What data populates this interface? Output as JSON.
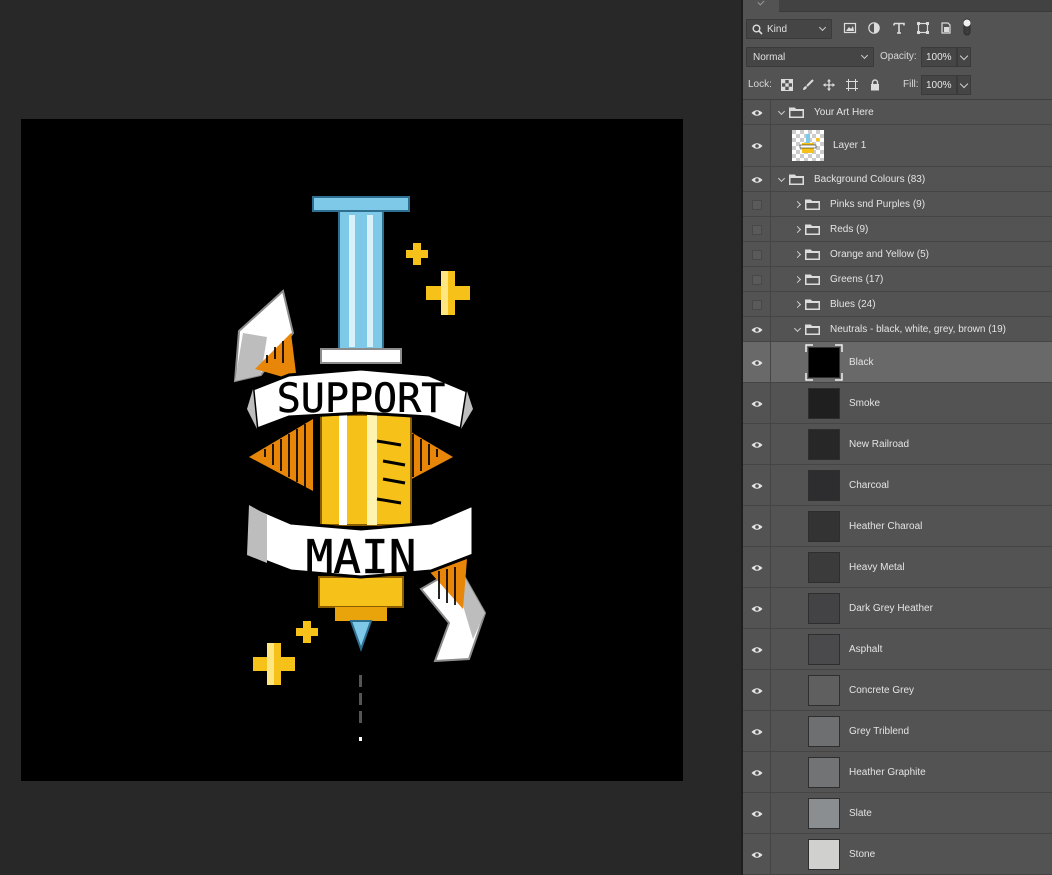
{
  "panel": {
    "filter": {
      "kind_label": "Kind",
      "icons": [
        "search-icon",
        "image-filter-icon",
        "adjustment-filter-icon",
        "type-filter-icon",
        "shape-filter-icon",
        "smart-object-filter-icon",
        "filter-toggle-icon"
      ]
    },
    "blend": {
      "mode": "Normal",
      "opacity_label": "Opacity:",
      "opacity_value": "100%"
    },
    "lock": {
      "label": "Lock:",
      "icons": [
        "lock-transparent-icon",
        "lock-paint-icon",
        "lock-position-icon",
        "lock-artboard-icon",
        "lock-all-icon"
      ],
      "fill_label": "Fill:",
      "fill_value": "100%"
    }
  },
  "layers": [
    {
      "type": "group",
      "name": "Your Art Here",
      "visible": true,
      "expanded": true,
      "depth": 0
    },
    {
      "type": "layer",
      "name": "Layer 1",
      "visible": true,
      "depth": 1,
      "thumb": "art"
    },
    {
      "type": "group",
      "name": "Background Colours (83)",
      "visible": true,
      "expanded": true,
      "depth": 0
    },
    {
      "type": "group",
      "name": "Pinks snd Purples (9)",
      "visible": false,
      "expanded": false,
      "depth": 1
    },
    {
      "type": "group",
      "name": "Reds (9)",
      "visible": false,
      "expanded": false,
      "depth": 1
    },
    {
      "type": "group",
      "name": "Orange and Yellow (5)",
      "visible": false,
      "expanded": false,
      "depth": 1
    },
    {
      "type": "group",
      "name": "Greens (17)",
      "visible": false,
      "expanded": false,
      "depth": 1
    },
    {
      "type": "group",
      "name": "Blues (24)",
      "visible": false,
      "expanded": false,
      "depth": 1
    },
    {
      "type": "group",
      "name": "Neutrals - black, white, grey, brown (19)",
      "visible": true,
      "expanded": true,
      "depth": 1
    },
    {
      "type": "fill",
      "name": "Black",
      "visible": true,
      "selected": true,
      "color": "#000000"
    },
    {
      "type": "fill",
      "name": "Smoke",
      "visible": true,
      "color": "#1f1f1f"
    },
    {
      "type": "fill",
      "name": "New Railroad",
      "visible": true,
      "color": "#272727"
    },
    {
      "type": "fill",
      "name": "Charcoal",
      "visible": true,
      "color": "#2d2d2f"
    },
    {
      "type": "fill",
      "name": "Heather Charoal",
      "visible": true,
      "color": "#333334"
    },
    {
      "type": "fill",
      "name": "Heavy Metal",
      "visible": true,
      "color": "#3b3b3c"
    },
    {
      "type": "fill",
      "name": "Dark Grey Heather",
      "visible": true,
      "color": "#434345"
    },
    {
      "type": "fill",
      "name": "Asphalt",
      "visible": true,
      "color": "#4a4a4c"
    },
    {
      "type": "fill",
      "name": "Concrete Grey",
      "visible": true,
      "color": "#5f5f60"
    },
    {
      "type": "fill",
      "name": "Grey Triblend",
      "visible": true,
      "color": "#6e6f71"
    },
    {
      "type": "fill",
      "name": "Heather Graphite",
      "visible": true,
      "color": "#727375"
    },
    {
      "type": "fill",
      "name": "Slate",
      "visible": true,
      "color": "#8b8e90"
    },
    {
      "type": "fill",
      "name": "Stone",
      "visible": true,
      "color": "#d0d0cf"
    }
  ],
  "artwork": {
    "banner_top": "SUPPORT",
    "banner_bottom": "MAIN",
    "colors": {
      "blade": "#7ec8e8",
      "gold": "#f6c21a",
      "orange": "#e8860a",
      "ribbon": "#ffffff",
      "shade": "#b9b9b9"
    }
  }
}
